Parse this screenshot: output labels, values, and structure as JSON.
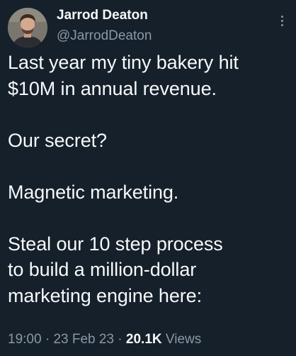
{
  "author": {
    "name": "Jarrod Deaton",
    "handle": "@JarrodDeaton"
  },
  "tweet": {
    "lines": [
      "Last year my tiny bakery hit",
      "$10M in annual revenue.",
      "",
      "Our secret?",
      "",
      "Magnetic marketing.",
      "",
      "Steal our 10 step process",
      "to build a million-dollar",
      "marketing engine here:"
    ]
  },
  "meta": {
    "time": "19:00",
    "separator": "·",
    "date": "23 Feb 23",
    "views_count": "20.1K",
    "views_label": "Views"
  },
  "icons": {
    "more": "more-horizontal-icon",
    "avatar": "profile-photo"
  },
  "colors": {
    "background": "#15202b",
    "primary_text": "#f7f9f9",
    "secondary_text": "#8b98a5"
  }
}
